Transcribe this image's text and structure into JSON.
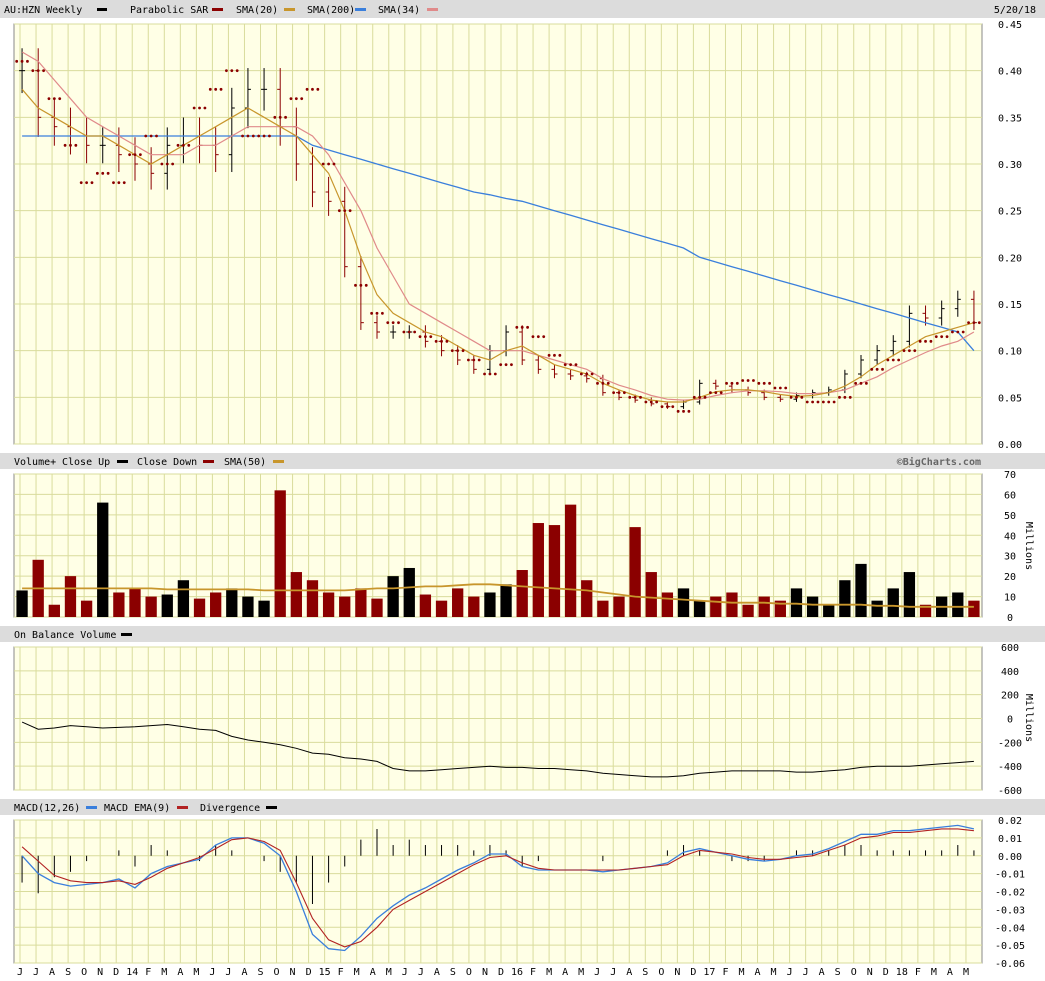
{
  "header": {
    "symbol": "AU:HZN Weekly",
    "date": "5/20/18",
    "legend": [
      {
        "label": "Parabolic SAR",
        "color": "#8b0000"
      },
      {
        "label": "SMA(20)",
        "color": "#c8962c"
      },
      {
        "label": "SMA(200)",
        "color": "#3a7fdc"
      },
      {
        "label": "SMA(34)",
        "color": "#e08a8a"
      }
    ]
  },
  "volume_header": {
    "title": "Volume+",
    "close_up": "Close Up",
    "close_down": "Close Down",
    "sma": "SMA(50)",
    "watermark": "©BigCharts.com"
  },
  "obv_header": {
    "title": "On Balance Volume"
  },
  "macd_header": {
    "title": "MACD(12,26)",
    "ema": "MACD EMA(9)",
    "divergence": "Divergence"
  },
  "units": {
    "volume": "Millions",
    "obv": "Millions"
  },
  "colors": {
    "panel_bg": "#ffffe6",
    "grid": "#d9dc9c",
    "up": "#000000",
    "down": "#8b0000",
    "sar": "#8b0000",
    "sma20": "#c8962c",
    "sma200": "#3a7fdc",
    "sma34": "#e08a8a",
    "macd": "#3a7fdc",
    "macd_ema": "#b22222",
    "vol_sma": "#c8962c"
  },
  "chart_data": [
    {
      "type": "line",
      "panel": "price",
      "ylim": [
        0,
        0.45
      ],
      "y_ticks": [
        "0.00",
        "0.05",
        "0.10",
        "0.15",
        "0.20",
        "0.25",
        "0.30",
        "0.35",
        "0.40",
        "0.45"
      ],
      "x_ticks": [
        "J",
        "J",
        "A",
        "S",
        "O",
        "N",
        "D",
        "14",
        "F",
        "M",
        "A",
        "M",
        "J",
        "J",
        "A",
        "S",
        "O",
        "N",
        "D",
        "15",
        "F",
        "M",
        "A",
        "M",
        "J",
        "J",
        "A",
        "S",
        "O",
        "N",
        "D",
        "16",
        "F",
        "M",
        "A",
        "M",
        "J",
        "J",
        "A",
        "S",
        "O",
        "N",
        "D",
        "17",
        "F",
        "M",
        "A",
        "M",
        "J",
        "J",
        "A",
        "S",
        "O",
        "N",
        "D",
        "18",
        "F",
        "M",
        "A",
        "M"
      ],
      "series": [
        {
          "name": "Close",
          "values": [
            0.4,
            0.35,
            0.34,
            0.33,
            0.32,
            0.32,
            0.31,
            0.3,
            0.29,
            0.32,
            0.33,
            0.32,
            0.31,
            0.36,
            0.38,
            0.38,
            0.34,
            0.3,
            0.27,
            0.26,
            0.19,
            0.13,
            0.12,
            0.12,
            0.12,
            0.11,
            0.1,
            0.09,
            0.08,
            0.1,
            0.12,
            0.09,
            0.08,
            0.075,
            0.073,
            0.07,
            0.055,
            0.05,
            0.047,
            0.043,
            0.04,
            0.045,
            0.065,
            0.062,
            0.058,
            0.055,
            0.05,
            0.048,
            0.052,
            0.055,
            0.058,
            0.075,
            0.09,
            0.1,
            0.11,
            0.14,
            0.135,
            0.145,
            0.155,
            0.13
          ]
        },
        {
          "name": "Parabolic SAR",
          "values": [
            0.41,
            0.4,
            0.37,
            0.32,
            0.28,
            0.29,
            0.28,
            0.31,
            0.33,
            0.3,
            0.32,
            0.36,
            0.38,
            0.4,
            0.33,
            0.33,
            0.35,
            0.37,
            0.38,
            0.3,
            0.25,
            0.17,
            0.14,
            0.13,
            0.12,
            0.115,
            0.11,
            0.1,
            0.09,
            0.075,
            0.085,
            0.125,
            0.115,
            0.095,
            0.085,
            0.075,
            0.065,
            0.055,
            0.05,
            0.045,
            0.04,
            0.035,
            0.05,
            0.055,
            0.065,
            0.068,
            0.065,
            0.06,
            0.05,
            0.045,
            0.045,
            0.05,
            0.065,
            0.08,
            0.09,
            0.1,
            0.11,
            0.115,
            0.12,
            0.13
          ]
        },
        {
          "name": "SMA(20)",
          "values": [
            0.38,
            0.36,
            0.35,
            0.34,
            0.33,
            0.33,
            0.32,
            0.31,
            0.3,
            0.31,
            0.32,
            0.33,
            0.34,
            0.35,
            0.36,
            0.35,
            0.34,
            0.33,
            0.31,
            0.29,
            0.25,
            0.2,
            0.16,
            0.14,
            0.13,
            0.12,
            0.115,
            0.105,
            0.095,
            0.09,
            0.1,
            0.105,
            0.095,
            0.085,
            0.08,
            0.075,
            0.065,
            0.058,
            0.052,
            0.047,
            0.045,
            0.045,
            0.05,
            0.056,
            0.058,
            0.058,
            0.056,
            0.053,
            0.051,
            0.052,
            0.055,
            0.062,
            0.072,
            0.085,
            0.095,
            0.105,
            0.115,
            0.12,
            0.125,
            0.13
          ]
        },
        {
          "name": "SMA(200)",
          "values": [
            0.33,
            0.33,
            0.33,
            0.33,
            0.33,
            0.33,
            0.33,
            0.33,
            0.33,
            0.33,
            0.33,
            0.33,
            0.33,
            0.33,
            0.33,
            0.33,
            0.33,
            0.33,
            0.32,
            0.315,
            0.31,
            0.305,
            0.3,
            0.295,
            0.29,
            0.285,
            0.28,
            0.275,
            0.27,
            0.267,
            0.263,
            0.26,
            0.255,
            0.25,
            0.245,
            0.24,
            0.235,
            0.23,
            0.225,
            0.22,
            0.215,
            0.21,
            0.2,
            0.195,
            0.19,
            0.185,
            0.18,
            0.175,
            0.17,
            0.165,
            0.16,
            0.155,
            0.15,
            0.145,
            0.14,
            0.135,
            0.13,
            0.125,
            0.12,
            0.1
          ]
        },
        {
          "name": "SMA(34)",
          "values": [
            0.42,
            0.41,
            0.39,
            0.37,
            0.35,
            0.34,
            0.33,
            0.32,
            0.31,
            0.31,
            0.31,
            0.32,
            0.32,
            0.33,
            0.34,
            0.34,
            0.34,
            0.34,
            0.33,
            0.31,
            0.28,
            0.25,
            0.21,
            0.18,
            0.15,
            0.14,
            0.13,
            0.12,
            0.11,
            0.1,
            0.1,
            0.1,
            0.095,
            0.09,
            0.085,
            0.08,
            0.07,
            0.063,
            0.058,
            0.052,
            0.048,
            0.047,
            0.048,
            0.052,
            0.055,
            0.057,
            0.057,
            0.056,
            0.054,
            0.054,
            0.055,
            0.058,
            0.065,
            0.072,
            0.082,
            0.09,
            0.098,
            0.105,
            0.11,
            0.12
          ]
        }
      ]
    },
    {
      "type": "bar",
      "panel": "volume",
      "ylabel": "Millions",
      "ylim": [
        0,
        70
      ],
      "y_ticks": [
        "0",
        "10",
        "20",
        "30",
        "40",
        "50",
        "60",
        "70"
      ],
      "series": [
        {
          "name": "Volume",
          "values": [
            13,
            28,
            6,
            20,
            8,
            56,
            12,
            14,
            10,
            11,
            18,
            9,
            12,
            14,
            10,
            8,
            62,
            22,
            18,
            12,
            10,
            14,
            9,
            20,
            24,
            11,
            8,
            14,
            10,
            12,
            16,
            23,
            46,
            45,
            55,
            18,
            8,
            10,
            44,
            22,
            12,
            14,
            8,
            10,
            12,
            6,
            10,
            8,
            14,
            10,
            6,
            18,
            26,
            8,
            14,
            22,
            6,
            10,
            12,
            8
          ]
        },
        {
          "name": "SMA(50)",
          "values": [
            14,
            14,
            14,
            14,
            14,
            14,
            14,
            14,
            14,
            13.5,
            13.5,
            13.5,
            13.5,
            13.5,
            13.5,
            13,
            13,
            13,
            13,
            13,
            13,
            13.5,
            14,
            14,
            14.5,
            15,
            15,
            15.5,
            16,
            16,
            15.5,
            15,
            14.5,
            14,
            13.5,
            13,
            12,
            11,
            10,
            9.5,
            9,
            8.5,
            8,
            7.5,
            7,
            7,
            7,
            6.5,
            6.5,
            6,
            6,
            6,
            6,
            5.5,
            5.5,
            5,
            5,
            5,
            5,
            5
          ]
        }
      ]
    },
    {
      "type": "line",
      "panel": "obv",
      "ylabel": "Millions",
      "ylim": [
        -600,
        600
      ],
      "y_ticks": [
        "600",
        "400",
        "200",
        "0",
        "-200",
        "-400",
        "-600"
      ],
      "series": [
        {
          "name": "On Balance Volume",
          "values": [
            -30,
            -90,
            -80,
            -60,
            -70,
            -80,
            -75,
            -70,
            -60,
            -50,
            -70,
            -90,
            -100,
            -150,
            -180,
            -200,
            -220,
            -250,
            -290,
            -300,
            -330,
            -340,
            -360,
            -420,
            -440,
            -440,
            -430,
            -420,
            -410,
            -400,
            -410,
            -410,
            -420,
            -420,
            -430,
            -440,
            -460,
            -470,
            -480,
            -490,
            -490,
            -480,
            -460,
            -450,
            -440,
            -440,
            -440,
            -440,
            -450,
            -450,
            -440,
            -430,
            -410,
            -400,
            -400,
            -400,
            -390,
            -380,
            -370,
            -360
          ]
        }
      ]
    },
    {
      "type": "line",
      "panel": "macd",
      "ylim": [
        -0.06,
        0.02
      ],
      "y_ticks": [
        "0.02",
        "0.01",
        "0.00",
        "-0.01",
        "-0.02",
        "-0.03",
        "-0.04",
        "-0.05",
        "-0.06"
      ],
      "series": [
        {
          "name": "MACD(12,26)",
          "values": [
            0.0,
            -0.01,
            -0.015,
            -0.017,
            -0.016,
            -0.015,
            -0.013,
            -0.018,
            -0.01,
            -0.006,
            -0.004,
            -0.002,
            0.006,
            0.01,
            0.01,
            0.007,
            0.0,
            -0.02,
            -0.044,
            -0.052,
            -0.053,
            -0.045,
            -0.035,
            -0.028,
            -0.022,
            -0.018,
            -0.013,
            -0.008,
            -0.004,
            0.001,
            0.001,
            -0.006,
            -0.008,
            -0.008,
            -0.008,
            -0.008,
            -0.009,
            -0.008,
            -0.007,
            -0.006,
            -0.004,
            0.002,
            0.004,
            0.002,
            0.0,
            -0.002,
            -0.003,
            -0.002,
            0.0,
            0.001,
            0.004,
            0.008,
            0.012,
            0.012,
            0.014,
            0.014,
            0.015,
            0.016,
            0.017,
            0.015
          ]
        },
        {
          "name": "MACD EMA(9)",
          "values": [
            0.005,
            -0.003,
            -0.011,
            -0.014,
            -0.015,
            -0.015,
            -0.014,
            -0.016,
            -0.012,
            -0.007,
            -0.004,
            -0.001,
            0.004,
            0.009,
            0.01,
            0.008,
            0.003,
            -0.015,
            -0.035,
            -0.047,
            -0.051,
            -0.048,
            -0.04,
            -0.03,
            -0.025,
            -0.02,
            -0.015,
            -0.01,
            -0.005,
            -0.001,
            0.0,
            -0.004,
            -0.007,
            -0.008,
            -0.008,
            -0.008,
            -0.008,
            -0.008,
            -0.007,
            -0.006,
            -0.005,
            0.0,
            0.003,
            0.002,
            0.001,
            -0.001,
            -0.002,
            -0.002,
            -0.001,
            0.0,
            0.003,
            0.006,
            0.01,
            0.011,
            0.013,
            0.013,
            0.014,
            0.015,
            0.015,
            0.014
          ]
        }
      ]
    }
  ]
}
